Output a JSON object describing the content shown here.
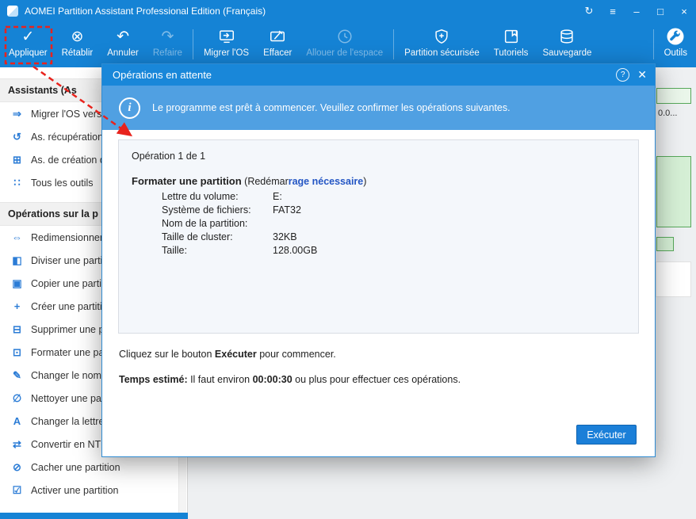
{
  "titlebar": {
    "title": "AOMEI Partition Assistant Professional Edition (Français)"
  },
  "window_controls": {
    "refresh": "↻",
    "menu": "≡",
    "minimize": "–",
    "maximize": "□",
    "close": "×"
  },
  "toolbar": {
    "items": [
      {
        "label": "Appliquer",
        "icon": "✓"
      },
      {
        "label": "Rétablir",
        "icon": "⊗"
      },
      {
        "label": "Annuler",
        "icon": "↶"
      },
      {
        "label": "Refaire",
        "icon": "↷"
      },
      {
        "label": "Migrer l'OS"
      },
      {
        "label": "Effacer"
      },
      {
        "label": "Allouer de l'espace"
      },
      {
        "label": "Partition sécurisée"
      },
      {
        "label": "Tutoriels"
      },
      {
        "label": "Sauvegarde"
      },
      {
        "label": "Outils"
      }
    ]
  },
  "sidebar": {
    "sections": [
      {
        "header": "Assistants (As",
        "items": [
          {
            "label": "Migrer l'OS vers",
            "icon": "⇒"
          },
          {
            "label": "As. récupération",
            "icon": "↺"
          },
          {
            "label": "As. de création d",
            "icon": "⊞"
          },
          {
            "label": "Tous les outils",
            "icon": "∷"
          }
        ]
      },
      {
        "header": "Opérations sur la p",
        "items": [
          {
            "label": "Redimensionner",
            "icon": "⇔"
          },
          {
            "label": "Diviser une parti",
            "icon": "◧"
          },
          {
            "label": "Copier une parti",
            "icon": "▣"
          },
          {
            "label": "Créer une partiti",
            "icon": "+"
          },
          {
            "label": "Supprimer une p",
            "icon": "⊟"
          },
          {
            "label": "Formater une pa",
            "icon": "⊡"
          },
          {
            "label": "Changer le nom",
            "icon": "✎"
          },
          {
            "label": "Nettoyer une pa",
            "icon": "∅"
          },
          {
            "label": "Changer la lettre",
            "icon": "A"
          },
          {
            "label": "Convertir en NTF",
            "icon": "⇄"
          },
          {
            "label": "Cacher une partition",
            "icon": "⊘"
          },
          {
            "label": "Activer une partition",
            "icon": "☑"
          }
        ]
      }
    ]
  },
  "right_panel": {
    "fragment_text": "0.0..."
  },
  "dialog": {
    "title": "Opérations en attente",
    "help": "?",
    "close": "✕",
    "info_glyph": "i",
    "banner_text": "Le programme est prêt à commencer. Veuillez confirmer les opérations suivantes.",
    "op_counter": "Opération 1 de 1",
    "op_title": "Formater une partition",
    "restart_prefix": " (Redémar",
    "restart_highlight": "rage nécessaire",
    "restart_suffix": ")",
    "fields": [
      {
        "label": "Lettre du volume:",
        "value": "E:"
      },
      {
        "label": "Système de fichiers:",
        "value": "FAT32"
      },
      {
        "label": "Nom de la partition:",
        "value": ""
      },
      {
        "label": "Taille de cluster:",
        "value": "32KB"
      },
      {
        "label": "Taille:",
        "value": "128.00GB"
      }
    ],
    "hint_prefix": "Cliquez sur le bouton ",
    "hint_bold": "Exécuter",
    "hint_suffix": " pour commencer.",
    "time_label": "Temps estimé:",
    "time_mid": " Il faut environ ",
    "time_value": "00:00:30",
    "time_suffix": " ou plus pour effectuer ces opérations.",
    "execute_label": "Exécuter"
  },
  "colors": {
    "accent": "#1583d5",
    "banner": "#50a0e2",
    "highlight": "#2456c4",
    "annotation": "#e8231d",
    "button": "#1b7fd8"
  }
}
